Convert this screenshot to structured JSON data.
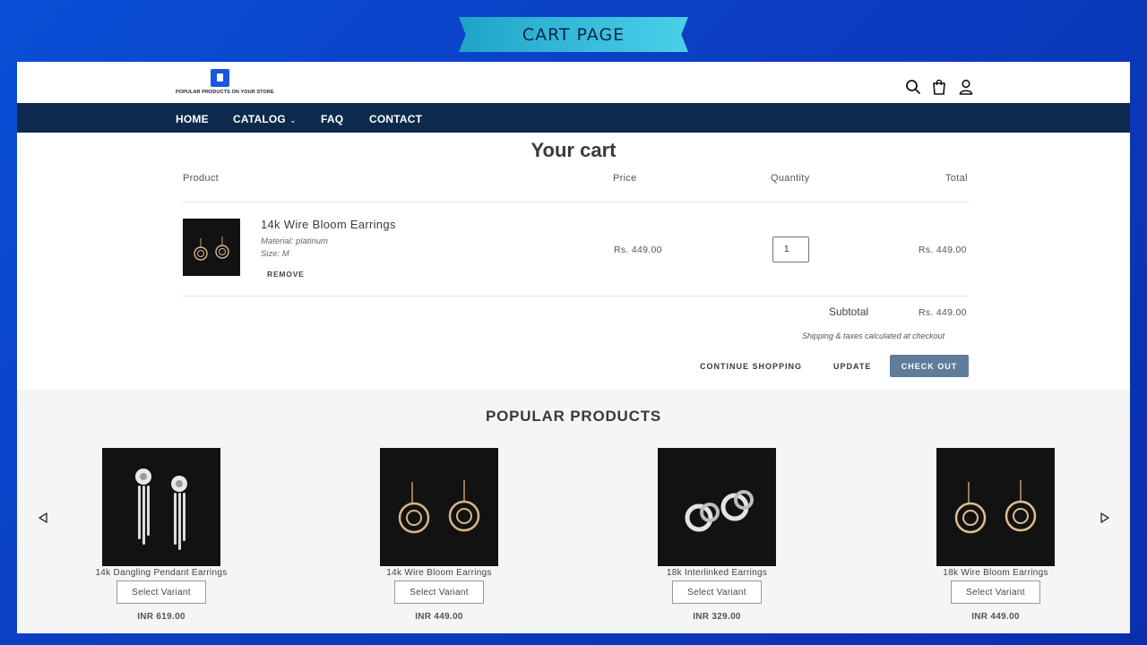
{
  "banner": {
    "title": "CART PAGE"
  },
  "header": {
    "logo_text": "POPULAR PRODUCTS ON YOUR STORE",
    "icons": [
      "search-icon",
      "bag-icon",
      "user-icon"
    ]
  },
  "nav": {
    "items": [
      {
        "label": "HOME"
      },
      {
        "label": "CATALOG",
        "has_dropdown": true
      },
      {
        "label": "FAQ"
      },
      {
        "label": "CONTACT"
      }
    ]
  },
  "cart": {
    "title": "Your cart",
    "columns": {
      "product": "Product",
      "price": "Price",
      "quantity": "Quantity",
      "total": "Total"
    },
    "items": [
      {
        "name": "14k Wire Bloom Earrings",
        "material": "Material: platinum",
        "size": "Size: M",
        "remove_label": "REMOVE",
        "price": "Rs. 449.00",
        "quantity": "1",
        "total": "Rs. 449.00"
      }
    ],
    "subtotal_label": "Subtotal",
    "subtotal_value": "Rs. 449.00",
    "shipping_note": "Shipping & taxes calculated at checkout",
    "continue_label": "CONTINUE SHOPPING",
    "update_label": "UPDATE",
    "checkout_label": "CHECK OUT"
  },
  "popular": {
    "title": "POPULAR PRODUCTS",
    "products": [
      {
        "name": "14k Dangling Pendant Earrings",
        "select_label": "Select Variant",
        "price": "INR 619.00"
      },
      {
        "name": "14k Wire Bloom Earrings",
        "select_label": "Select Variant",
        "price": "INR 449.00"
      },
      {
        "name": "18k Interlinked Earrings",
        "select_label": "Select Variant",
        "price": "INR 329.00"
      },
      {
        "name": "18k Wire Bloom Earrings",
        "select_label": "Select Variant",
        "price": "INR 449.00"
      }
    ]
  },
  "colors": {
    "nav_bg": "#0d2a4e",
    "checkout_bg": "#5f7c9a",
    "banner_bg": "#2fb9dc",
    "page_bg": "#0b44d0"
  }
}
